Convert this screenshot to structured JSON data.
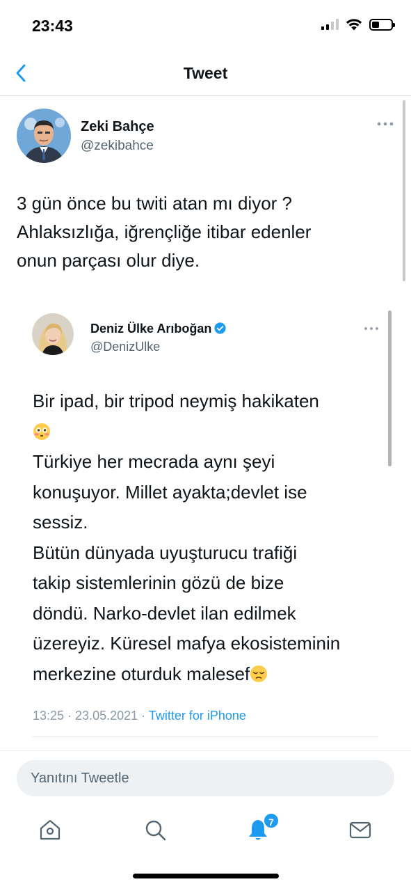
{
  "status_bar": {
    "time": "23:43"
  },
  "nav": {
    "title": "Tweet"
  },
  "tweet": {
    "author_name": "Zeki Bahçe",
    "author_handle": "@zekibahce",
    "text": "3 gün önce bu twiti atan mı diyor ?\nAhlaksızlığa, iğrençliğe itibar edenler\nonun parçası olur diye."
  },
  "quoted_tweet": {
    "author_name": "Deniz Ülke Arıboğan",
    "author_handle": "@DenizUlke",
    "text_part1": "Bir ipad, bir tripod  neymiş hakikaten\n",
    "emoji1": "flushed-face-emoji",
    "text_part2": "\nTürkiye her mecrada aynı şeyi\nkonuşuyor. Millet ayakta;devlet ise\nsessiz.\nBütün dünyada uyuşturucu trafiği\ntakip sistemlerinin gözü de bize\ndöndü. Narko-devlet ilan edilmek\nüzereyiz. Küresel mafya ekosisteminin\nmerkezine oturduk malesef",
    "emoji2": "pensive-face-emoji",
    "timestamp": "13:25 · 23.05.2021 · ",
    "source": "Twitter for iPhone"
  },
  "reply": {
    "placeholder": "Yanıtını Tweetle"
  },
  "tabbar": {
    "icons": [
      "home-icon",
      "search-icon",
      "notifications-icon",
      "messages-icon"
    ],
    "notification_count": "7"
  },
  "colors": {
    "accent": "#1d9bf0",
    "text": "#0f1419",
    "secondary": "#536471"
  }
}
